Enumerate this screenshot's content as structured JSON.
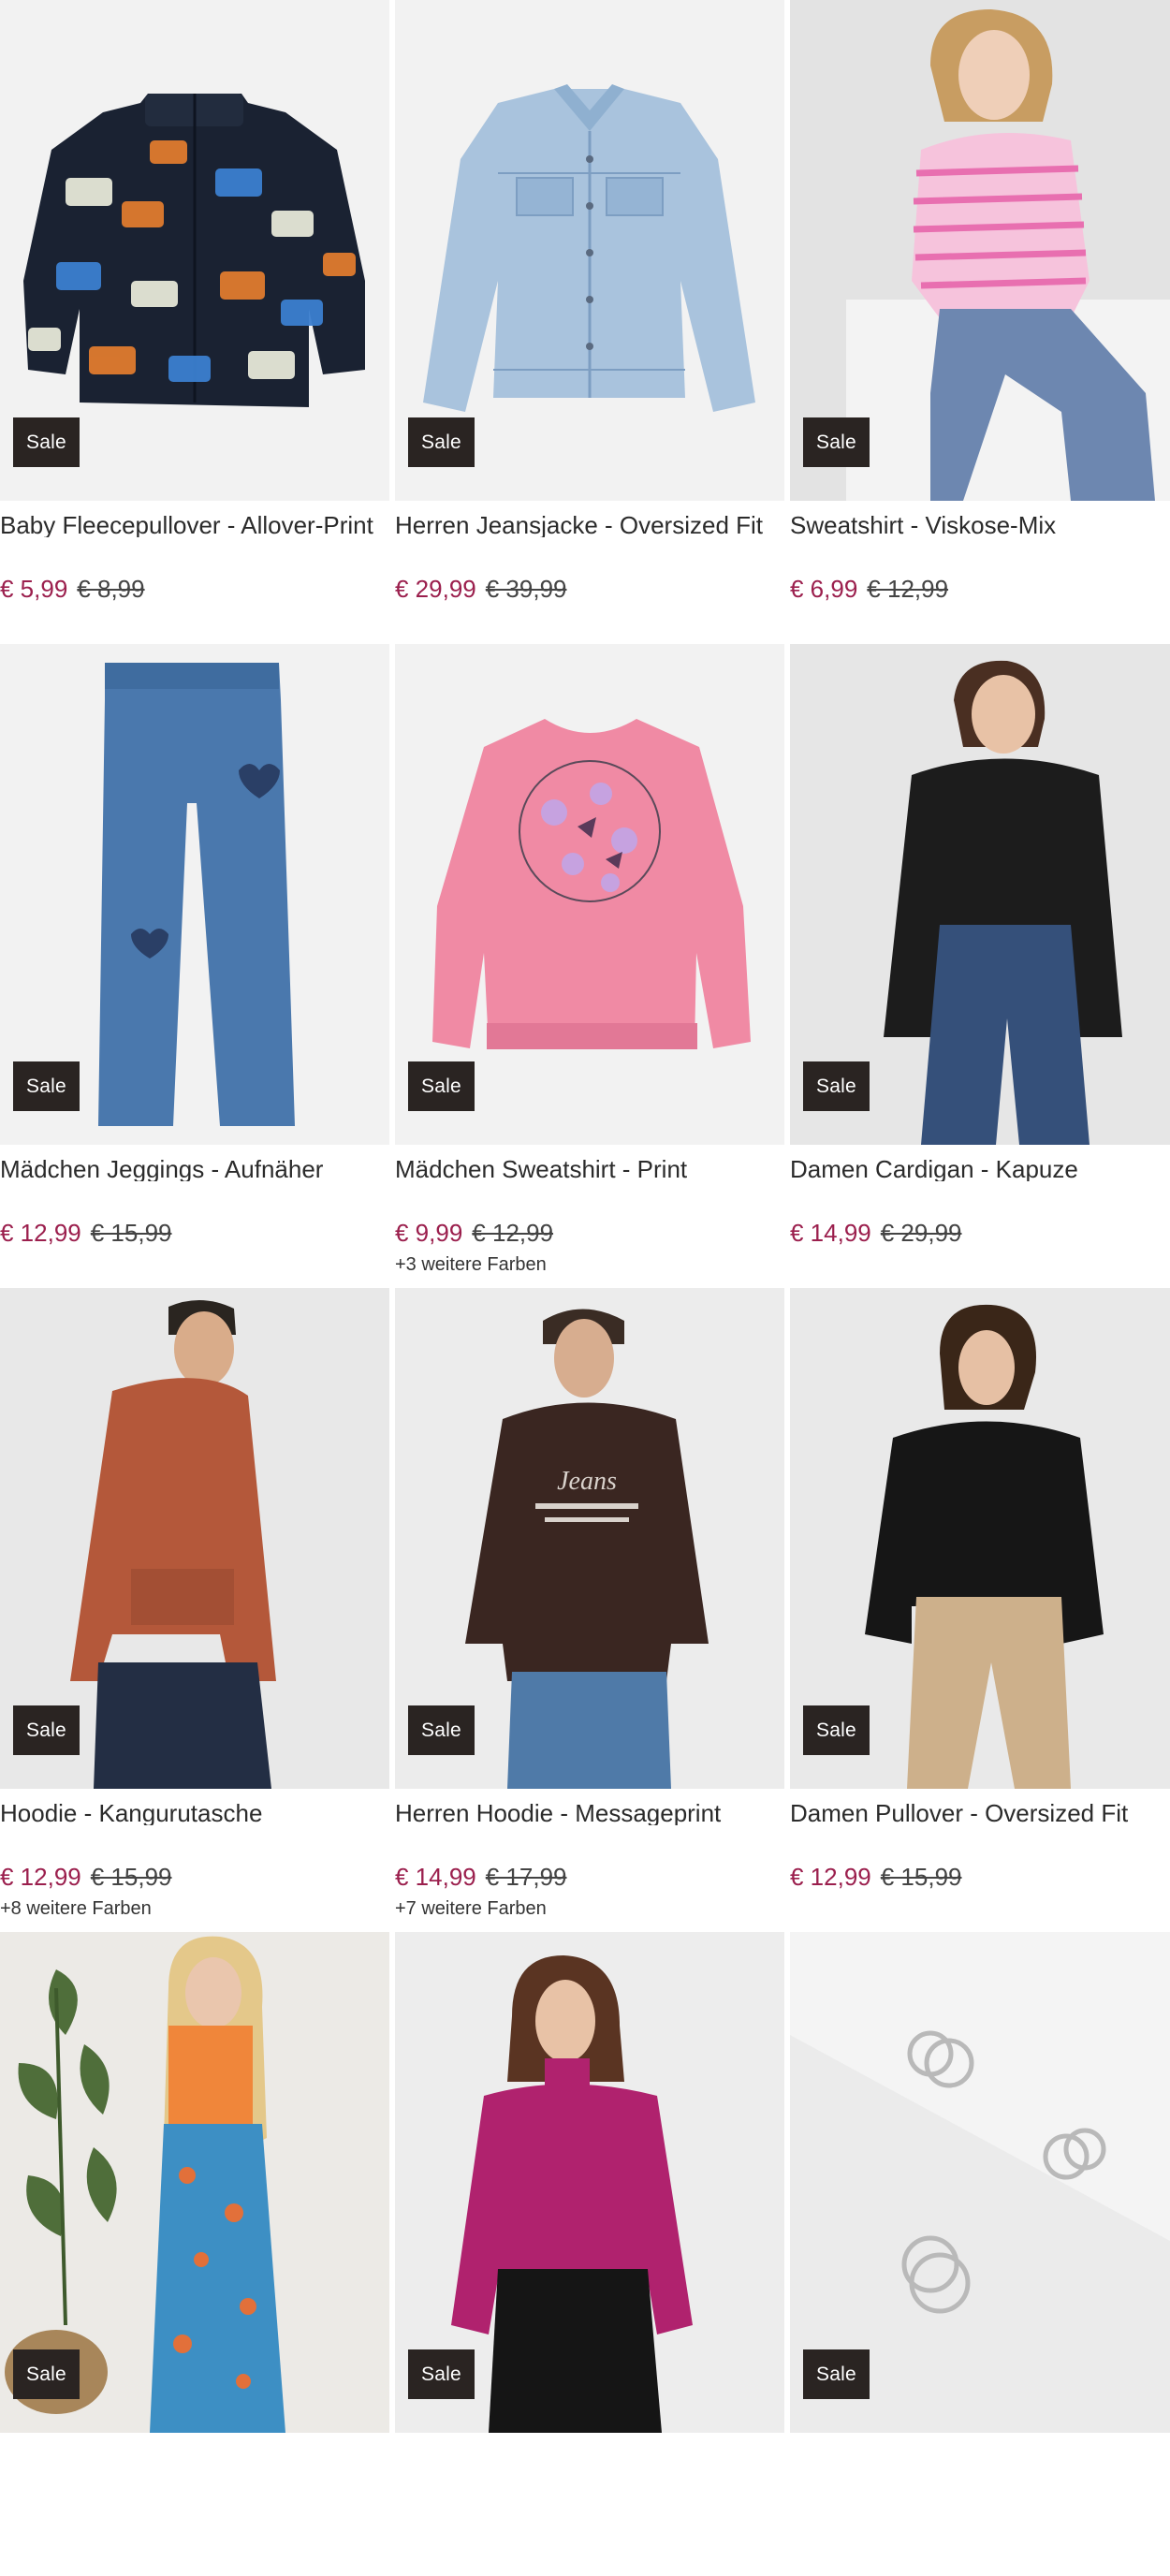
{
  "sale_badge": "Sale",
  "products": [
    {
      "title": "Baby Fleecepullover - Allover-Print",
      "price": "€ 5,99",
      "old_price": "€ 8,99",
      "more_colors": ""
    },
    {
      "title": "Herren Jeansjacke - Oversized Fit",
      "price": "€ 29,99",
      "old_price": "€ 39,99",
      "more_colors": ""
    },
    {
      "title": "Sweatshirt - Viskose-Mix",
      "price": "€ 6,99",
      "old_price": "€ 12,99",
      "more_colors": ""
    },
    {
      "title": "Mädchen Jeggings - Aufnäher",
      "price": "€ 12,99",
      "old_price": "€ 15,99",
      "more_colors": ""
    },
    {
      "title": "Mädchen Sweatshirt - Print",
      "price": "€ 9,99",
      "old_price": "€ 12,99",
      "more_colors": "+3 weitere Farben"
    },
    {
      "title": "Damen Cardigan - Kapuze",
      "price": "€ 14,99",
      "old_price": "€ 29,99",
      "more_colors": ""
    },
    {
      "title": "Hoodie - Kangurutasche",
      "price": "€ 12,99",
      "old_price": "€ 15,99",
      "more_colors": "+8 weitere Farben"
    },
    {
      "title": "Herren Hoodie - Messageprint",
      "price": "€ 14,99",
      "old_price": "€ 17,99",
      "more_colors": "+7 weitere Farben"
    },
    {
      "title": "Damen Pullover - Oversized Fit",
      "price": "€ 12,99",
      "old_price": "€ 15,99",
      "more_colors": ""
    },
    {
      "title": "",
      "price": "",
      "old_price": "",
      "more_colors": ""
    },
    {
      "title": "",
      "price": "",
      "old_price": "",
      "more_colors": ""
    },
    {
      "title": "",
      "price": "",
      "old_price": "",
      "more_colors": ""
    }
  ],
  "colors": {
    "price": "#9b1f4d",
    "badge_bg": "#2a2422",
    "image_bg": "#f2f2f2"
  }
}
